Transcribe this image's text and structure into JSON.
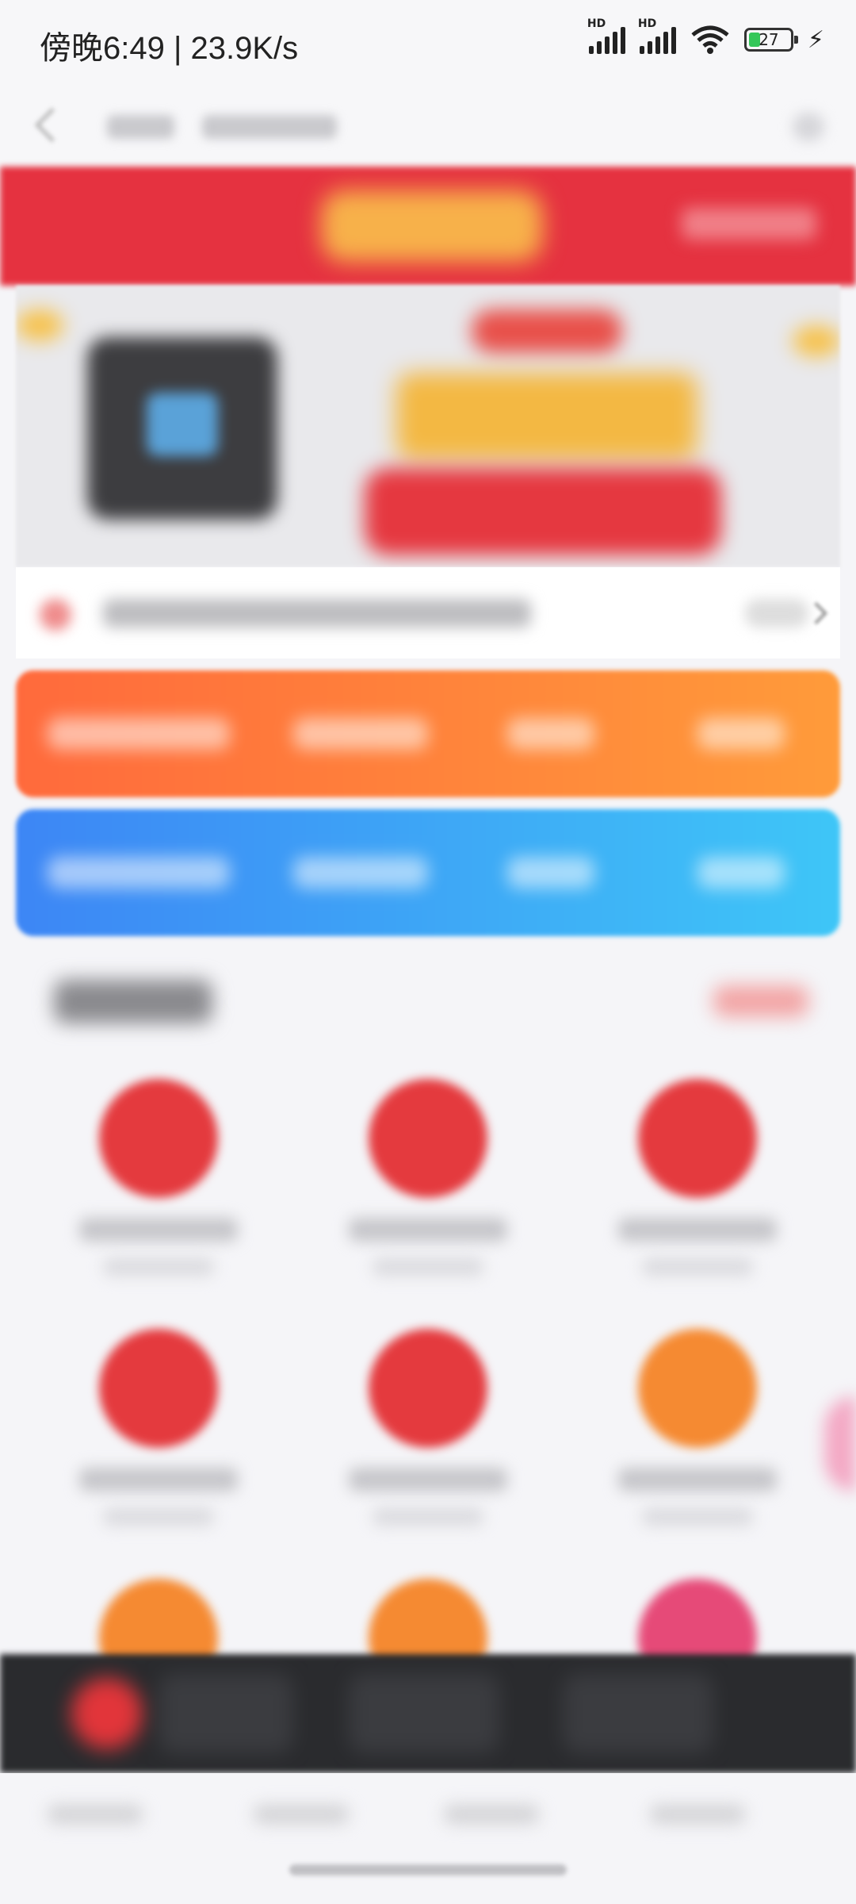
{
  "status_bar": {
    "time_speed": "傍晚6:49 | 23.9K/s",
    "signal1_label": "HD",
    "signal2_label": "HD",
    "battery_level": "27",
    "icons": [
      "signal-icon",
      "signal-icon",
      "wifi-icon",
      "battery-icon",
      "charging-icon"
    ]
  },
  "grid": {
    "items": [
      {
        "color": "#e43a3e"
      },
      {
        "color": "#e43a3e"
      },
      {
        "color": "#e43a3e"
      },
      {
        "color": "#e43a3e"
      },
      {
        "color": "#e43a3e"
      },
      {
        "color": "#f58a32"
      },
      {
        "color": "#f58a32"
      },
      {
        "color": "#f58a32"
      },
      {
        "color": "#e64a78"
      }
    ]
  },
  "colors": {
    "accent_red": "#e53240",
    "orange_card": "#ff7a3b",
    "blue_card": "#3f9af6"
  }
}
